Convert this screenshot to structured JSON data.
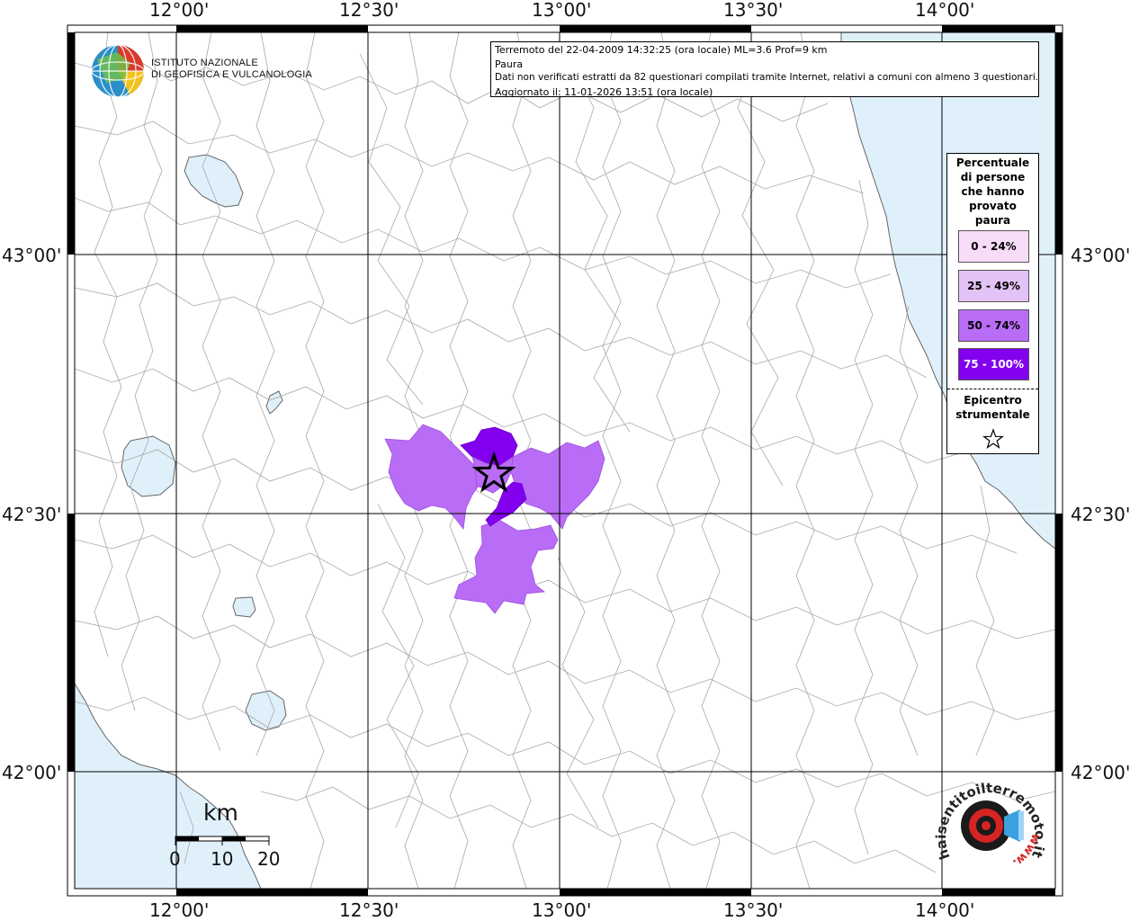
{
  "map": {
    "top_lon_labels": [
      "12°00'",
      "12°30'",
      "13°00'",
      "13°30'",
      "14°00'"
    ],
    "bottom_lon_labels": [
      "12°00'",
      "12°30'",
      "13°00'",
      "13°30'",
      "14°00'"
    ],
    "left_lat_labels": [
      "43°00'",
      "42°30'",
      "42°00'"
    ],
    "right_lat_labels": [
      "43°00'",
      "42°30'",
      "42°00'"
    ],
    "colors": {
      "sea": "#dff0fb",
      "border_lines": "#9a9a9a",
      "grid": "#000000",
      "class_0_24": "#f7ddf7",
      "class_25_49": "#e3c3f5",
      "class_50_74": "#b96cf5",
      "class_75_100": "#8200ee"
    }
  },
  "info": {
    "line1": "Terremoto del 22-04-2009 14:32:25 (ora locale) ML=3.6 Prof=9 km",
    "line2": "Paura",
    "line3": "Dati non verificati estratti da 82 questionari compilati tramite Internet, relativi a comuni con almeno 3 questionari.",
    "line4": "Aggiornato il: 11-01-2026 13:51 (ora locale)"
  },
  "legend": {
    "title_lines": [
      "Percentuale",
      "di persone",
      "che hanno",
      "provato",
      "paura"
    ],
    "classes": [
      {
        "label": "0 - 24%",
        "color": "#f7ddf7",
        "text_color": "#000000"
      },
      {
        "label": "25 - 49%",
        "color": "#e3c3f5",
        "text_color": "#000000"
      },
      {
        "label": "50 - 74%",
        "color": "#b96cf5",
        "text_color": "#000000"
      },
      {
        "label": "75 - 100%",
        "color": "#8200ee",
        "text_color": "#ffffff"
      }
    ],
    "epicenter_lines": [
      "Epicentro",
      "strumentale"
    ],
    "epicenter_icon": "star-outline-icon"
  },
  "logo": {
    "org_line1": "ISTITUTO NAZIONALE",
    "org_line2": "DI GEOFISICA E VULCANOLOGIA",
    "icon": "globe-icon"
  },
  "scale_bar": {
    "unit": "km",
    "ticks": [
      "0",
      "10",
      "20"
    ]
  },
  "hsi_logo": {
    "text": "haisentitoilterremoto.it",
    "url_text": "www.",
    "icon": "alarm-siren-icon"
  }
}
